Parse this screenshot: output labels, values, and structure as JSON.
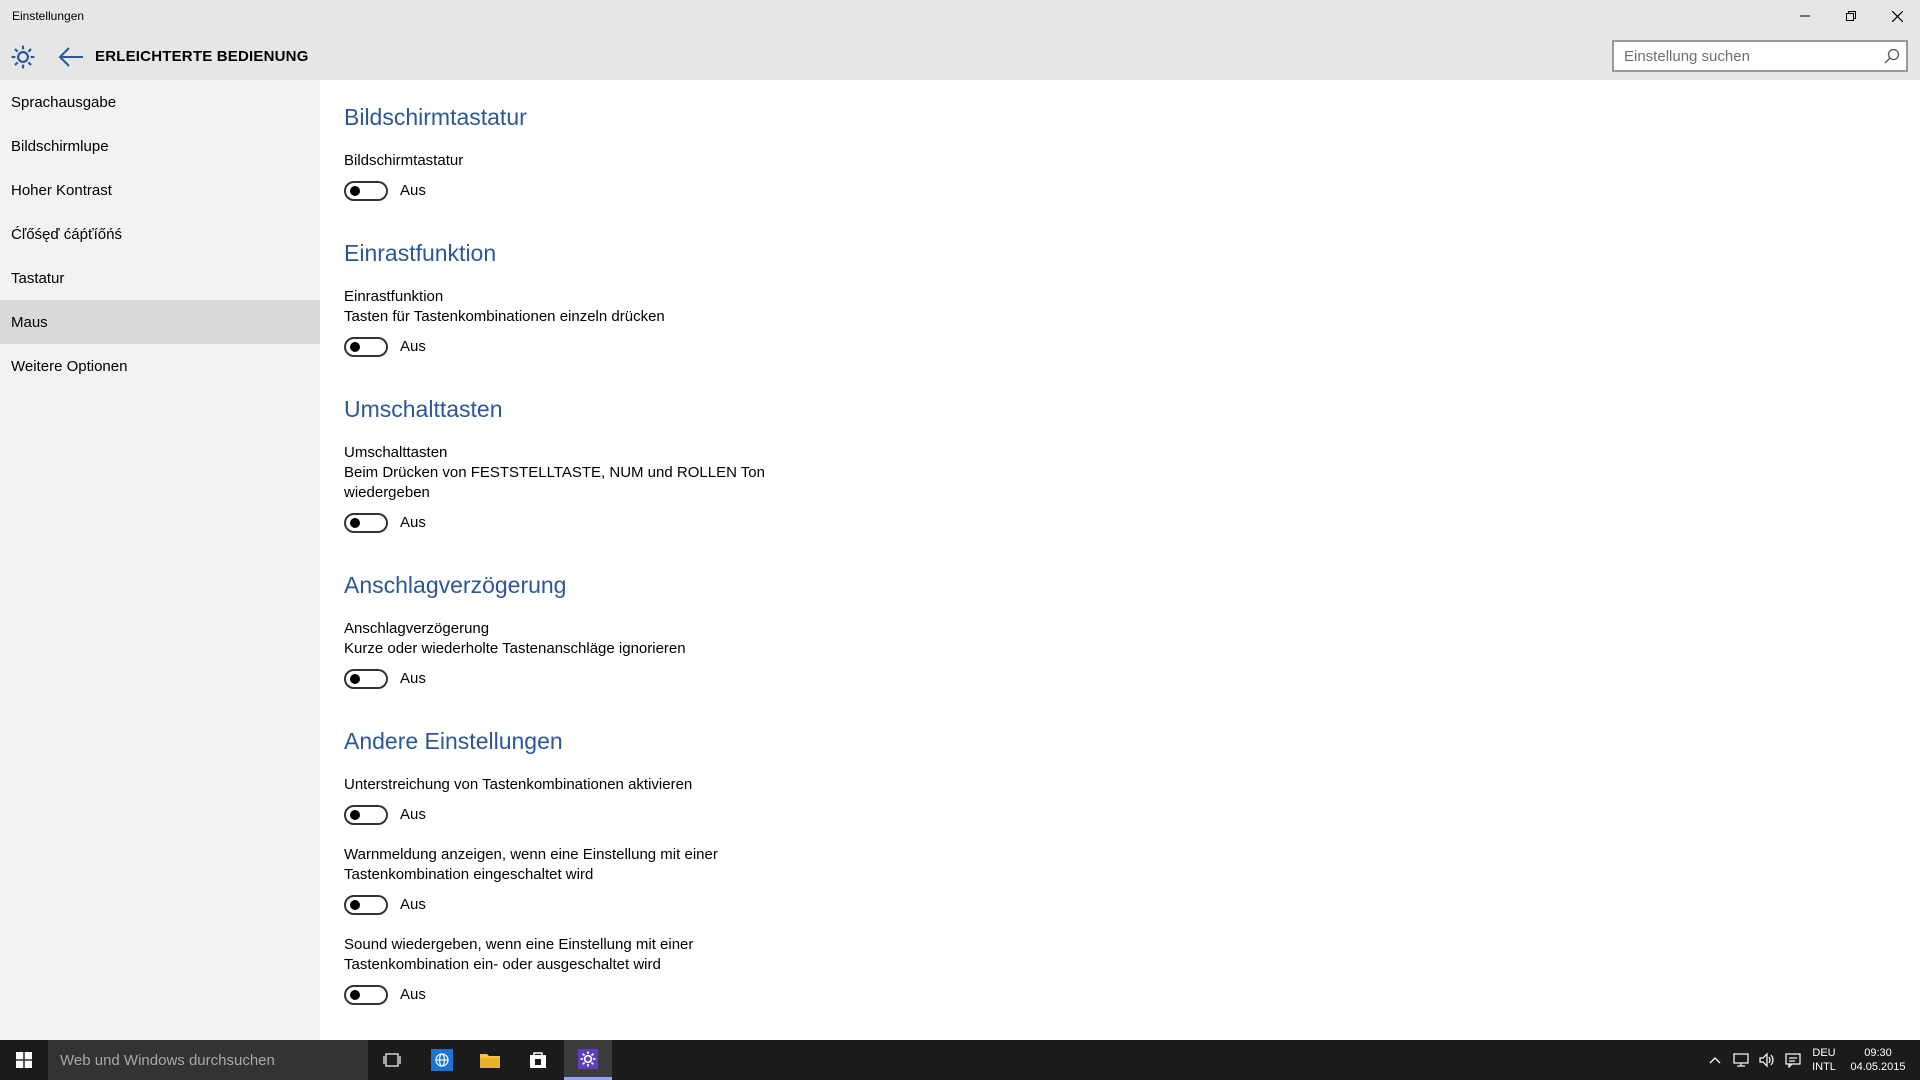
{
  "window": {
    "title": "Einstellungen"
  },
  "header": {
    "section_title": "ERLEICHTERTE BEDIENUNG",
    "search_placeholder": "Einstellung suchen"
  },
  "sidebar": {
    "items": [
      {
        "label": "Sprachausgabe",
        "selected": false
      },
      {
        "label": "Bildschirmlupe",
        "selected": false
      },
      {
        "label": "Hoher Kontrast",
        "selected": false
      },
      {
        "label": "Ćľőśęď ćáṕťíőńś",
        "selected": false
      },
      {
        "label": "Tastatur",
        "selected": false
      },
      {
        "label": "Maus",
        "selected": true
      },
      {
        "label": "Weitere Optionen",
        "selected": false
      }
    ]
  },
  "main": {
    "sections": [
      {
        "heading": "Bildschirmtastatur",
        "settings": [
          {
            "label": "Bildschirmtastatur",
            "description": "",
            "state": "Aus"
          }
        ]
      },
      {
        "heading": "Einrastfunktion",
        "settings": [
          {
            "label": "Einrastfunktion",
            "description": "Tasten für Tastenkombinationen einzeln drücken",
            "state": "Aus"
          }
        ]
      },
      {
        "heading": "Umschalttasten",
        "settings": [
          {
            "label": "Umschalttasten",
            "description_line1": "Beim Drücken von FESTSTELLTASTE, NUM und ROLLEN Ton",
            "description_line2": "wiedergeben",
            "state": "Aus"
          }
        ]
      },
      {
        "heading": "Anschlagverzögerung",
        "settings": [
          {
            "label": "Anschlagverzögerung",
            "description": "Kurze oder wiederholte Tastenanschläge ignorieren",
            "state": "Aus"
          }
        ]
      },
      {
        "heading": "Andere Einstellungen",
        "settings": [
          {
            "label": "Unterstreichung von Tastenkombinationen aktivieren",
            "state": "Aus"
          },
          {
            "label_line1": "Warnmeldung anzeigen, wenn eine Einstellung mit einer",
            "label_line2": "Tastenkombination eingeschaltet wird",
            "state": "Aus"
          },
          {
            "label_line1": "Sound wiedergeben, wenn eine Einstellung mit einer",
            "label_line2": "Tastenkombination ein- oder ausgeschaltet wird",
            "state": "Aus"
          }
        ]
      }
    ]
  },
  "taskbar": {
    "search_placeholder": "Web und Windows durchsuchen",
    "language_line1": "DEU",
    "language_line2": "INTL",
    "time": "09:30",
    "date": "04.05.2015"
  },
  "colors": {
    "accent": "#2b5797",
    "chrome": "#e6e6e6",
    "sidebar": "#f2f2f2",
    "selected": "#d9d9d9",
    "taskbar": "#1b1b1b"
  }
}
